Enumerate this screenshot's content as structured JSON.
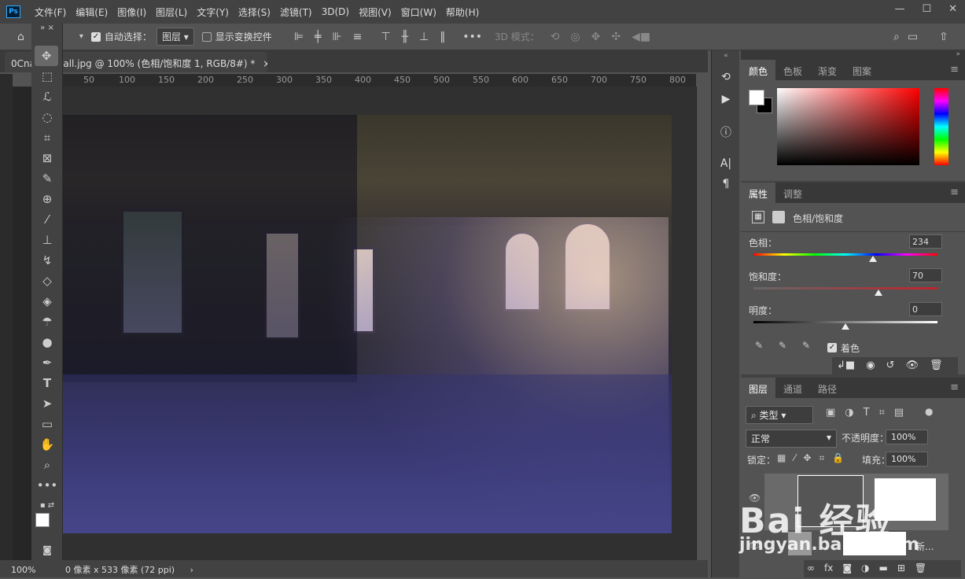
{
  "menubar": {
    "logo": "Ps",
    "items": [
      "文件(F)",
      "编辑(E)",
      "图像(I)",
      "图层(L)",
      "文字(Y)",
      "选择(S)",
      "滤镜(T)",
      "3D(D)",
      "视图(V)",
      "窗口(W)",
      "帮助(H)"
    ]
  },
  "options": {
    "auto_select_label": "自动选择：",
    "auto_select_value": "图层",
    "show_transform_label": "显示变换控件",
    "mode3d_label": "3D 模式："
  },
  "document": {
    "tab_title": "0Cna..._small.jpg @ 100% (色相/饱和度 1, RGB/8#) *",
    "close": "×"
  },
  "ruler": {
    "top_numbers": [
      "50",
      "100",
      "150",
      "200",
      "250",
      "300",
      "350",
      "400",
      "450",
      "500",
      "550",
      "600",
      "650",
      "700",
      "750",
      "800"
    ]
  },
  "status": {
    "zoom": "100%",
    "size_info": "0 像素 x 533 像素 (72 ppi)"
  },
  "color_panel": {
    "tabs": [
      "颜色",
      "色板",
      "渐变",
      "图案"
    ]
  },
  "properties_panel": {
    "tabs": [
      "属性",
      "调整"
    ],
    "adjustment_name": "色相/饱和度",
    "hue_label": "色相：",
    "hue_value": "234",
    "hue_pos": 0.65,
    "saturation_label": "饱和度：",
    "saturation_value": "70",
    "saturation_pos": 0.68,
    "lightness_label": "明度：",
    "lightness_value": "0",
    "lightness_pos": 0.5,
    "colorize_label": "着色"
  },
  "layers_panel": {
    "tabs": [
      "图层",
      "通道",
      "路径"
    ],
    "filter_label": "类型",
    "blend_mode": "正常",
    "opacity_label": "不透明度：",
    "opacity_value": "100%",
    "lock_label": "锁定：",
    "fill_label": "填充：",
    "fill_value": "100%",
    "layer2_name": "新..."
  },
  "watermark": {
    "text": "Bai  经验",
    "subtext": "jingyan.baidu.com"
  }
}
